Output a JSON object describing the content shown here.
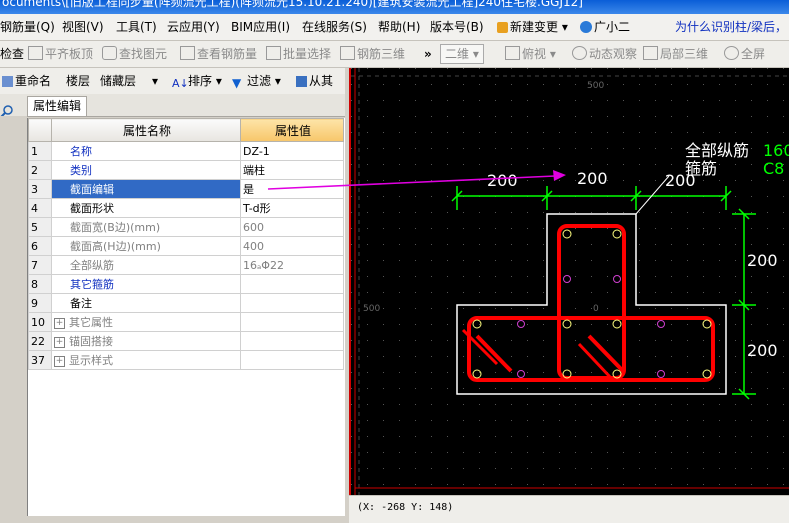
{
  "window": {
    "title": "ocuments\\[旧版工程同步量(阵频流光工程)(阵频流光15.10.21.240)[建筑安装流光工程]240住宅楼.GGJ12]"
  },
  "menu": {
    "items": [
      "钢筋量(Q)",
      "视图(V)",
      "工具(T)",
      "云应用(Y)",
      "BIM应用(I)",
      "在线服务(S)",
      "帮助(H)",
      "版本号(B)",
      "新建变更",
      "广小二"
    ],
    "right_text": "为什么识别柱/梁后，"
  },
  "toolbar": {
    "items": [
      "检查",
      "平齐板顶",
      "查找图元",
      "查看钢筋量",
      "批量选择",
      "钢筋三维",
      "»",
      "二维",
      "俯视",
      "动态观察",
      "局部三维",
      "全屏"
    ]
  },
  "toolbar3": {
    "items": [
      "重命名",
      "楼层",
      "储藏层",
      "排序",
      "过滤",
      "从其"
    ]
  },
  "panel": {
    "tab": "属性编辑",
    "columns": [
      "属性名称",
      "属性值"
    ],
    "rows": [
      {
        "num": "1",
        "name": "名称",
        "value": "DZ-1",
        "name_style": "blue"
      },
      {
        "num": "2",
        "name": "类别",
        "value": "端柱",
        "name_style": "blue"
      },
      {
        "num": "3",
        "name": "截面编辑",
        "value": "是",
        "name_style": "selected"
      },
      {
        "num": "4",
        "name": "截面形状",
        "value": "T-d形",
        "name_style": "dark"
      },
      {
        "num": "5",
        "name": "截面宽(B边)(mm)",
        "value": "600",
        "name_style": "gray"
      },
      {
        "num": "6",
        "name": "截面高(H边)(mm)",
        "value": "400",
        "name_style": "gray"
      },
      {
        "num": "7",
        "name": "全部纵筋",
        "value": "16ₐΦ22",
        "name_style": "gray"
      },
      {
        "num": "8",
        "name": "其它箍筋",
        "value": "",
        "name_style": "blue"
      },
      {
        "num": "9",
        "name": "备注",
        "value": "",
        "name_style": "dark"
      },
      {
        "num": "10",
        "name": "其它属性",
        "value": "",
        "name_style": "gray",
        "expand": "+"
      },
      {
        "num": "22",
        "name": "锚固搭接",
        "value": "",
        "name_style": "gray",
        "expand": "+"
      },
      {
        "num": "37",
        "name": "显示样式",
        "value": "",
        "name_style": "gray",
        "expand": "+"
      }
    ]
  },
  "canvas": {
    "axis_label_top": "500",
    "axis_label_left": "500",
    "axis_label_origin": "0",
    "dim_top": [
      "200",
      "200",
      "200"
    ],
    "dim_right": [
      "200",
      "200"
    ],
    "label_longitudinal": "全部纵筋",
    "label_stirrup": "箍筋",
    "label_long_value": "160",
    "label_stirrup_value": "C8"
  },
  "status": {
    "coords": "(X: -268 Y: 148)"
  },
  "colors": {
    "accent_selected": "#316ac5",
    "canvas_bg": "#000000",
    "rebar": "#ff0000",
    "dimension": "#00ff00",
    "arrow": "#e000e0"
  }
}
